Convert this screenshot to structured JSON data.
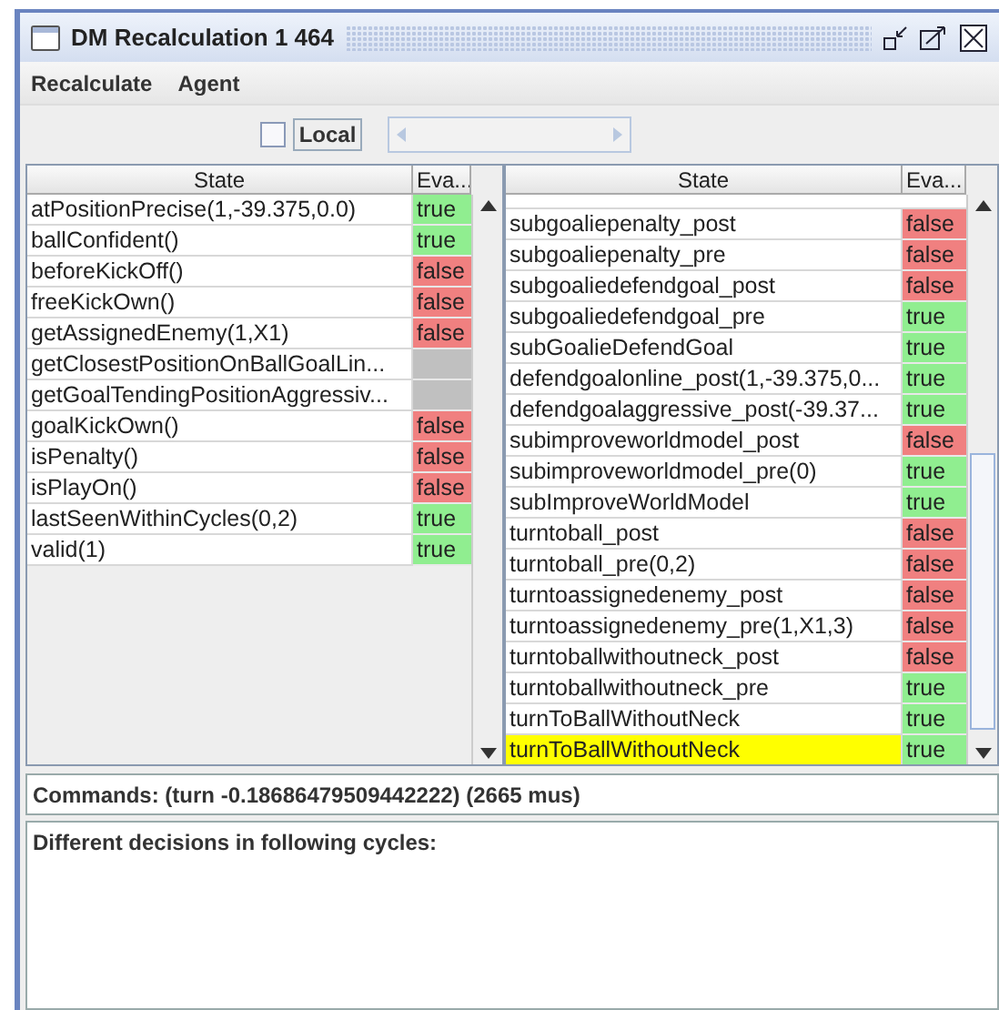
{
  "window": {
    "title": "DM Recalculation 1 464"
  },
  "menu": [
    "Recalculate",
    "Agent"
  ],
  "local": {
    "label": "Local",
    "checked": false
  },
  "left_table": {
    "columns": [
      "State",
      "Eva..."
    ],
    "rows": [
      {
        "state": "atPositionPrecise(1,-39.375,0.0)",
        "value": "true",
        "kind": "pass"
      },
      {
        "state": "ballConfident()",
        "value": "true",
        "kind": "pass"
      },
      {
        "state": "beforeKickOff()",
        "value": "false",
        "kind": "fail"
      },
      {
        "state": "freeKickOwn()",
        "value": "false",
        "kind": "fail"
      },
      {
        "state": "getAssignedEnemy(1,X1)",
        "value": "false",
        "kind": "fail"
      },
      {
        "state": "getClosestPositionOnBallGoalLin...",
        "kind": "none"
      },
      {
        "state": "getGoalTendingPositionAggressiv...",
        "kind": "none"
      },
      {
        "state": "goalKickOwn()",
        "value": "false",
        "kind": "fail"
      },
      {
        "state": "isPenalty()",
        "value": "false",
        "kind": "fail"
      },
      {
        "state": "isPlayOn()",
        "value": "false",
        "kind": "fail"
      },
      {
        "state": "lastSeenWithinCycles(0,2)",
        "value": "true",
        "kind": "pass"
      },
      {
        "state": "valid(1)",
        "value": "true",
        "kind": "pass"
      }
    ]
  },
  "right_table": {
    "columns": [
      "State",
      "Eva..."
    ],
    "rows": [
      {
        "state": "subgoaliepenalty_post",
        "value": "false",
        "kind": "fail",
        "selected": false
      },
      {
        "state": "subgoaliepenalty_pre",
        "value": "false",
        "kind": "fail",
        "selected": false
      },
      {
        "state": "subgoaliedefendgoal_post",
        "value": "false",
        "kind": "fail",
        "selected": false
      },
      {
        "state": "subgoaliedefendgoal_pre",
        "value": "true",
        "kind": "pass",
        "selected": false
      },
      {
        "state": "subGoalieDefendGoal",
        "value": "true",
        "kind": "pass",
        "selected": false
      },
      {
        "state": "defendgoalonline_post(1,-39.375,0...",
        "value": "true",
        "kind": "pass",
        "selected": false
      },
      {
        "state": "defendgoalaggressive_post(-39.37...",
        "value": "true",
        "kind": "pass",
        "selected": false
      },
      {
        "state": "subimproveworldmodel_post",
        "value": "false",
        "kind": "fail",
        "selected": false
      },
      {
        "state": "subimproveworldmodel_pre(0)",
        "value": "true",
        "kind": "pass",
        "selected": false
      },
      {
        "state": "subImproveWorldModel",
        "value": "true",
        "kind": "pass",
        "selected": false
      },
      {
        "state": "turntoball_post",
        "value": "false",
        "kind": "fail",
        "selected": false
      },
      {
        "state": "turntoball_pre(0,2)",
        "value": "false",
        "kind": "fail",
        "selected": false
      },
      {
        "state": "turntoassignedenemy_post",
        "value": "false",
        "kind": "fail",
        "selected": false
      },
      {
        "state": "turntoassignedenemy_pre(1,X1,3)",
        "value": "false",
        "kind": "fail",
        "selected": false
      },
      {
        "state": "turntoballwithoutneck_post",
        "value": "false",
        "kind": "fail",
        "selected": false
      },
      {
        "state": "turntoballwithoutneck_pre",
        "value": "true",
        "kind": "pass",
        "selected": false
      },
      {
        "state": "turnToBallWithoutNeck",
        "value": "true",
        "kind": "pass",
        "selected": false
      },
      {
        "state": "turnToBallWithoutNeck",
        "value": "true",
        "kind": "pass",
        "selected": true
      }
    ]
  },
  "commands": "Commands: (turn -0.18686479509442222) (2665 mus)",
  "decisions": "Different decisions in following cycles:"
}
